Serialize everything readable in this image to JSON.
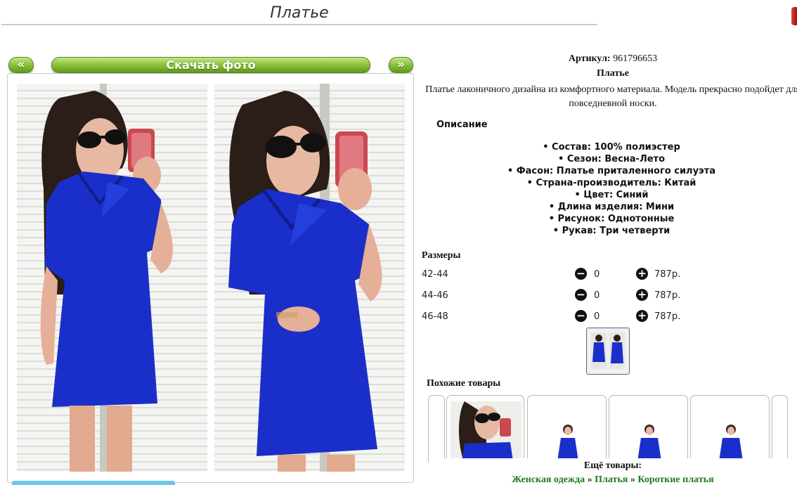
{
  "page": {
    "title": "Платье"
  },
  "gallery": {
    "prev_label": "«",
    "download_label": "Скачать фото",
    "next_label": "»"
  },
  "product": {
    "article_label": "Артикул:",
    "article_value": "961796653",
    "name": "Платье",
    "short_desc": "Платье лаконичного дизайна из комфортного материала. Модель прекрасно подойдет для повседневной носки.",
    "description_heading": "Описание",
    "attributes": [
      "Состав: 100% полиэстер",
      "Сезон: Весна-Лето",
      "Фасон: Платье приталенного силуэта",
      "Страна-производитель: Китай",
      "Цвет: Синий",
      "Длина изделия: Мини",
      "Рисунок: Однотонные",
      "Рукав: Три четверти"
    ]
  },
  "sizes": {
    "heading": "Размеры",
    "rows": [
      {
        "size": "42-44",
        "qty": "0",
        "price": "787р."
      },
      {
        "size": "44-46",
        "qty": "0",
        "price": "787р."
      },
      {
        "size": "46-48",
        "qty": "0",
        "price": "787р."
      }
    ],
    "minus_icon": "minus-circle-icon",
    "plus_icon": "plus-circle-icon"
  },
  "similar": {
    "heading": "Похожие товары"
  },
  "more": {
    "heading": "Ещё товары:",
    "crumbs": [
      "Женская одежда",
      "Платья",
      "Короткие платья"
    ],
    "separator": "»"
  },
  "colors": {
    "button_green": "#7bb52e",
    "dress_blue": "#1a2fc9",
    "link_green": "#1f7a1f"
  }
}
